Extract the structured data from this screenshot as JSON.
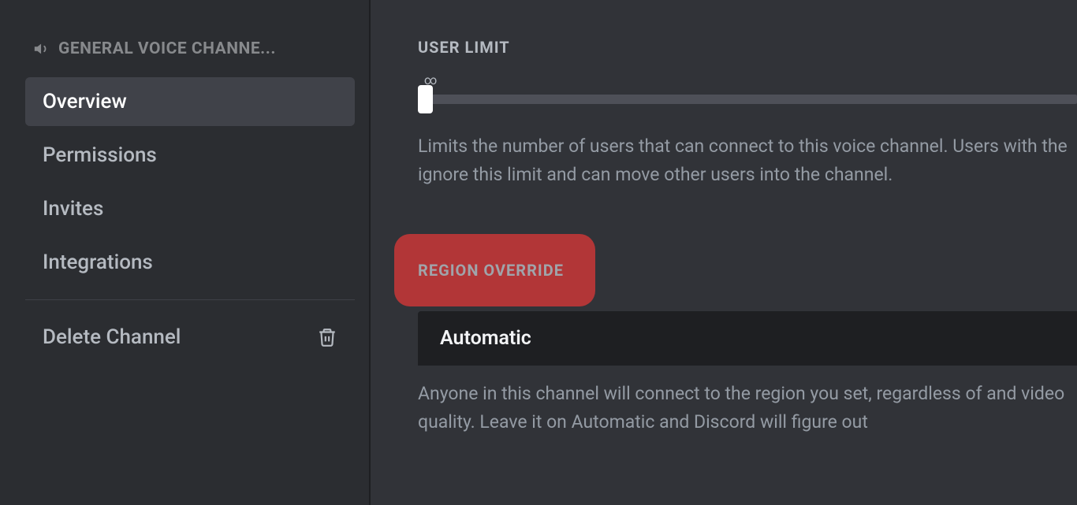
{
  "sidebar": {
    "header": "GENERAL  VOICE CHANNE...",
    "items": [
      {
        "label": "Overview",
        "active": true
      },
      {
        "label": "Permissions",
        "active": false
      },
      {
        "label": "Invites",
        "active": false
      },
      {
        "label": "Integrations",
        "active": false
      }
    ],
    "delete_label": "Delete Channel"
  },
  "main": {
    "user_limit": {
      "label": "USER LIMIT",
      "infinity": "∞",
      "help": "Limits the number of users that can connect to this voice channel. Users with the ignore this limit and can move other users into the channel."
    },
    "region": {
      "label": "REGION OVERRIDE",
      "selected": "Automatic",
      "help": "Anyone in this channel will connect to the region you set, regardless of and video quality. Leave it on Automatic and Discord will figure out"
    }
  }
}
